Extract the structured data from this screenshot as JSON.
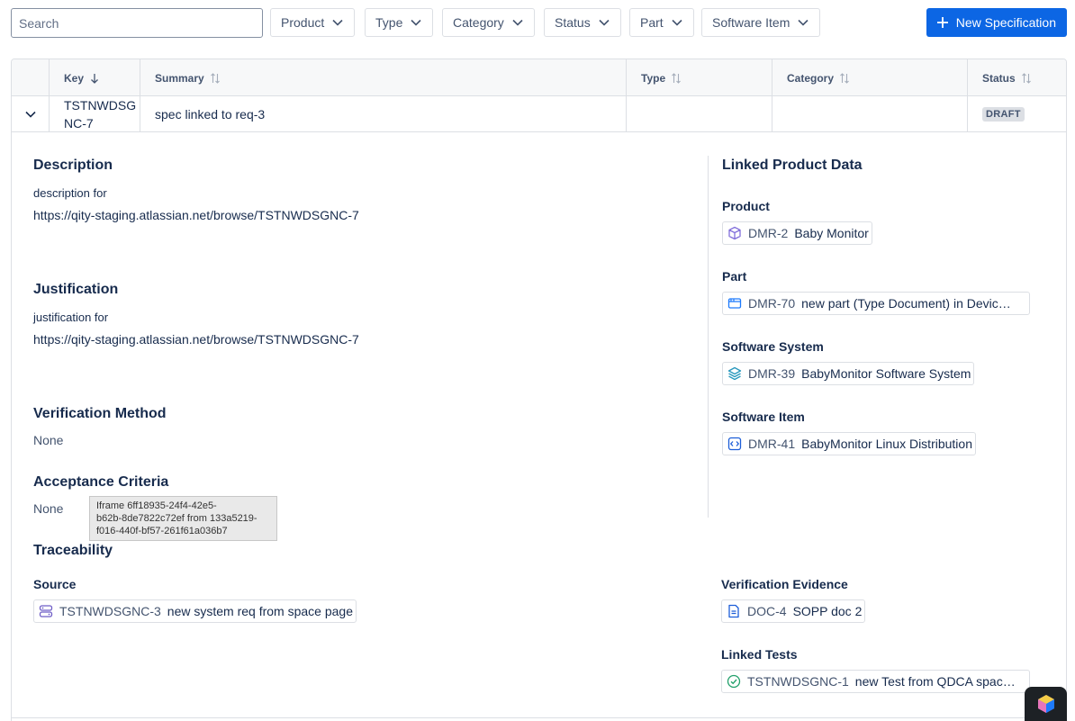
{
  "toolbar": {
    "search_placeholder": "Search",
    "filters": [
      "Product",
      "Type",
      "Category",
      "Status",
      "Part",
      "Software Item"
    ],
    "new_button": "New Specification"
  },
  "table": {
    "columns": [
      "Key",
      "Summary",
      "Type",
      "Category",
      "Status"
    ],
    "row": {
      "key": "TSTNWDSGNC-7",
      "key_line1": "TSTNWDSG",
      "key_line2": "NC-7",
      "summary": "spec linked to req-3",
      "type": "",
      "category": "",
      "status": "DRAFT"
    }
  },
  "detail": {
    "description_title": "Description",
    "description_line1": "description for",
    "description_line2": "https://qity-staging.atlassian.net/browse/TSTNWDSGNC-7",
    "justification_title": "Justification",
    "justification_line1": "justification for",
    "justification_line2": "https://qity-staging.atlassian.net/browse/TSTNWDSGNC-7",
    "verification_method_title": "Verification Method",
    "verification_method_value": "None",
    "acceptance_criteria_title": "Acceptance Criteria",
    "acceptance_criteria_value": "None",
    "tooltip_line1": "Iframe 6ff18935-24f4-42e5-",
    "tooltip_line2": "b62b-8de7822c72ef from 133a5219-",
    "tooltip_line3": "f016-440f-bf57-261f61a036b7",
    "traceability_title": "Traceability",
    "source_label": "Source",
    "source_key": "TSTNWDSGNC-3",
    "source_name": "new system req from space page",
    "verification_evidence_label": "Verification Evidence",
    "evidence_key": "DOC-4",
    "evidence_name": "SOPP doc 2",
    "linked_tests_label": "Linked Tests",
    "test_key": "TSTNWDSGNC-1",
    "test_name": "new Test from QDCA spac…"
  },
  "linked": {
    "title": "Linked Product Data",
    "product_label": "Product",
    "product_key": "DMR-2",
    "product_name": "Baby Monitor",
    "part_label": "Part",
    "part_key": "DMR-70",
    "part_name": "new part (Type Document) in Devic…",
    "software_system_label": "Software System",
    "software_system_key": "DMR-39",
    "software_system_name": "BabyMonitor Software System",
    "software_item_label": "Software Item",
    "software_item_key": "DMR-41",
    "software_item_name": "BabyMonitor Linux Distribution"
  },
  "colors": {
    "primary": "#0c66e4",
    "product_icon": "#8270db",
    "part_icon": "#1d7afc",
    "system_icon": "#2898bd",
    "test_icon": "#22a06b"
  }
}
